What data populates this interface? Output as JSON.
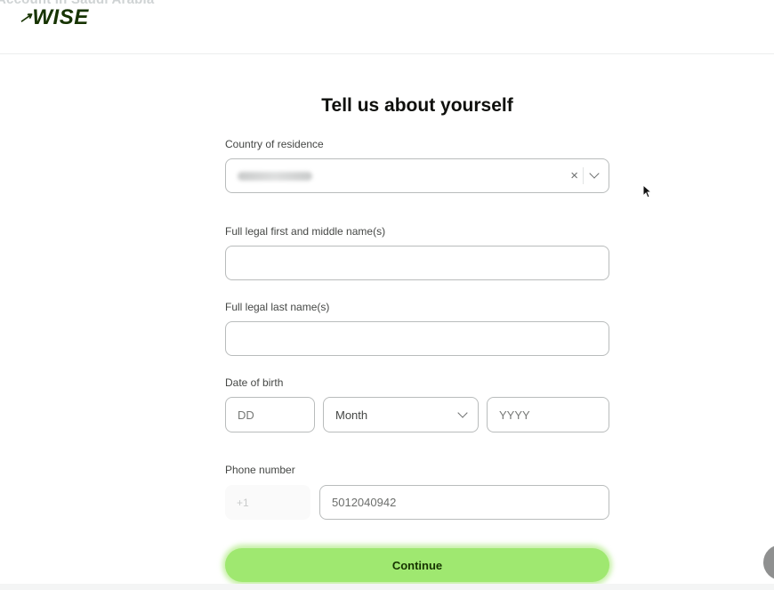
{
  "overlay_caption": "Account in Saudi Arabia",
  "brand": {
    "flag_glyph": "↗",
    "name": "WISE",
    "color": "#163300"
  },
  "form": {
    "title": "Tell us about yourself",
    "country": {
      "label": "Country of residence",
      "value": "",
      "clear_icon": "×"
    },
    "first_name": {
      "label": "Full legal first and middle name(s)",
      "value": ""
    },
    "last_name": {
      "label": "Full legal last name(s)",
      "value": ""
    },
    "dob": {
      "label": "Date of birth",
      "day_placeholder": "DD",
      "month_value": "Month",
      "year_placeholder": "YYYY"
    },
    "phone": {
      "label": "Phone number",
      "code": "+1",
      "value": "5012040942"
    },
    "continue_label": "Continue",
    "accent_color": "#9fe870"
  }
}
